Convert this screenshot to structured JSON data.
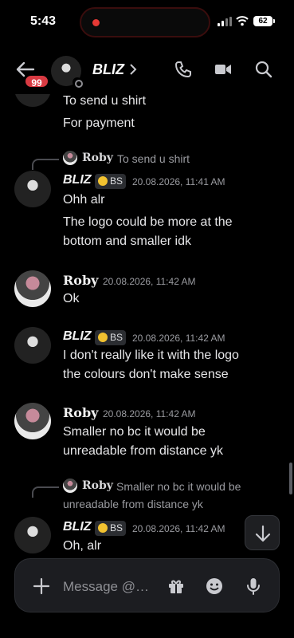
{
  "status_bar": {
    "time": "5:43",
    "battery": "62"
  },
  "header": {
    "unread_badge": "99",
    "channel_name": "BLIZ"
  },
  "messages": {
    "prev_tail": [
      "To send u shirt",
      "For payment"
    ],
    "m1": {
      "reply": {
        "author": "Roby",
        "text": "To send u shirt"
      },
      "author": "BLIZ",
      "tag": "BS",
      "time": "20.08.2026, 11:41 AM",
      "lines": [
        "Ohh alr",
        "The logo could be more at the",
        "bottom and smaller idk"
      ]
    },
    "m2": {
      "author": "Roby",
      "time": "20.08.2026, 11:42 AM",
      "lines": [
        "Ok"
      ]
    },
    "m3": {
      "author": "BLIZ",
      "tag": "BS",
      "time": "20.08.2026, 11:42 AM",
      "lines": [
        "I don't really like it with the logo",
        "the colours don't make sense"
      ]
    },
    "m4": {
      "author": "Roby",
      "time": "20.08.2026, 11:42 AM",
      "lines": [
        "Smaller no bc it would be",
        "unreadable from distance yk"
      ]
    },
    "m5": {
      "reply": {
        "author": "Roby",
        "text_line1": "Smaller no bc it would be",
        "text_line2": "unreadable from distance yk"
      },
      "author": "BLIZ",
      "tag": "BS",
      "time": "20.08.2026, 11:42 AM",
      "lines": [
        "Oh, alr"
      ]
    }
  },
  "composer": {
    "placeholder": "Message @…"
  },
  "icons": {
    "back": "arrow-left-icon",
    "call": "phone-icon",
    "video": "video-camera-icon",
    "search": "search-icon",
    "jump": "arrow-down-icon",
    "plus": "plus-icon",
    "gift": "gift-icon",
    "emoji": "emoji-icon",
    "mic": "microphone-icon"
  },
  "colors": {
    "badge": "#d83a42",
    "background": "#000000",
    "composer": "#1c1d21"
  }
}
